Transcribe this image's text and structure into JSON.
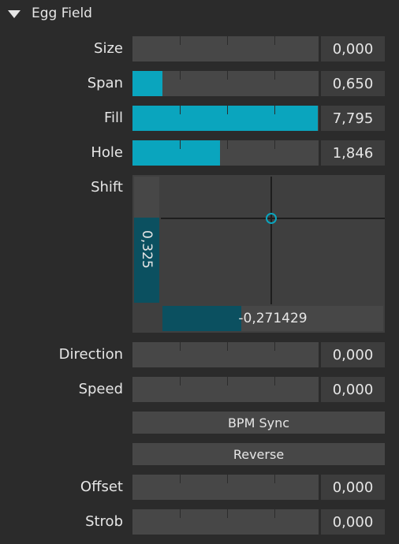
{
  "header": {
    "title": "Egg Field",
    "expand_icon": "triangle-down-icon"
  },
  "params": {
    "size": {
      "label": "Size",
      "value": "0,000",
      "fill": 0.0
    },
    "span": {
      "label": "Span",
      "value": "0,650",
      "fill": 0.16
    },
    "fill": {
      "label": "Fill",
      "value": "7,795",
      "fill": 0.995
    },
    "hole": {
      "label": "Hole",
      "value": "1,846",
      "fill": 0.47
    },
    "direction": {
      "label": "Direction",
      "value": "0,000",
      "fill": 0.0
    },
    "speed": {
      "label": "Speed",
      "value": "0,000",
      "fill": 0.0
    },
    "offset": {
      "label": "Offset",
      "value": "0,000",
      "fill": 0.0
    },
    "strob": {
      "label": "Strob",
      "value": "0,000",
      "fill": 0.0
    }
  },
  "shift": {
    "label": "Shift",
    "x_value": "-0,271429",
    "y_value": "0,325"
  },
  "buttons": {
    "bpm_sync": "BPM Sync",
    "reverse": "Reverse"
  },
  "colors": {
    "accent": "#0aa5be",
    "accent_dark": "#0b5060",
    "track": "#474747",
    "background": "#2b2b2b"
  }
}
